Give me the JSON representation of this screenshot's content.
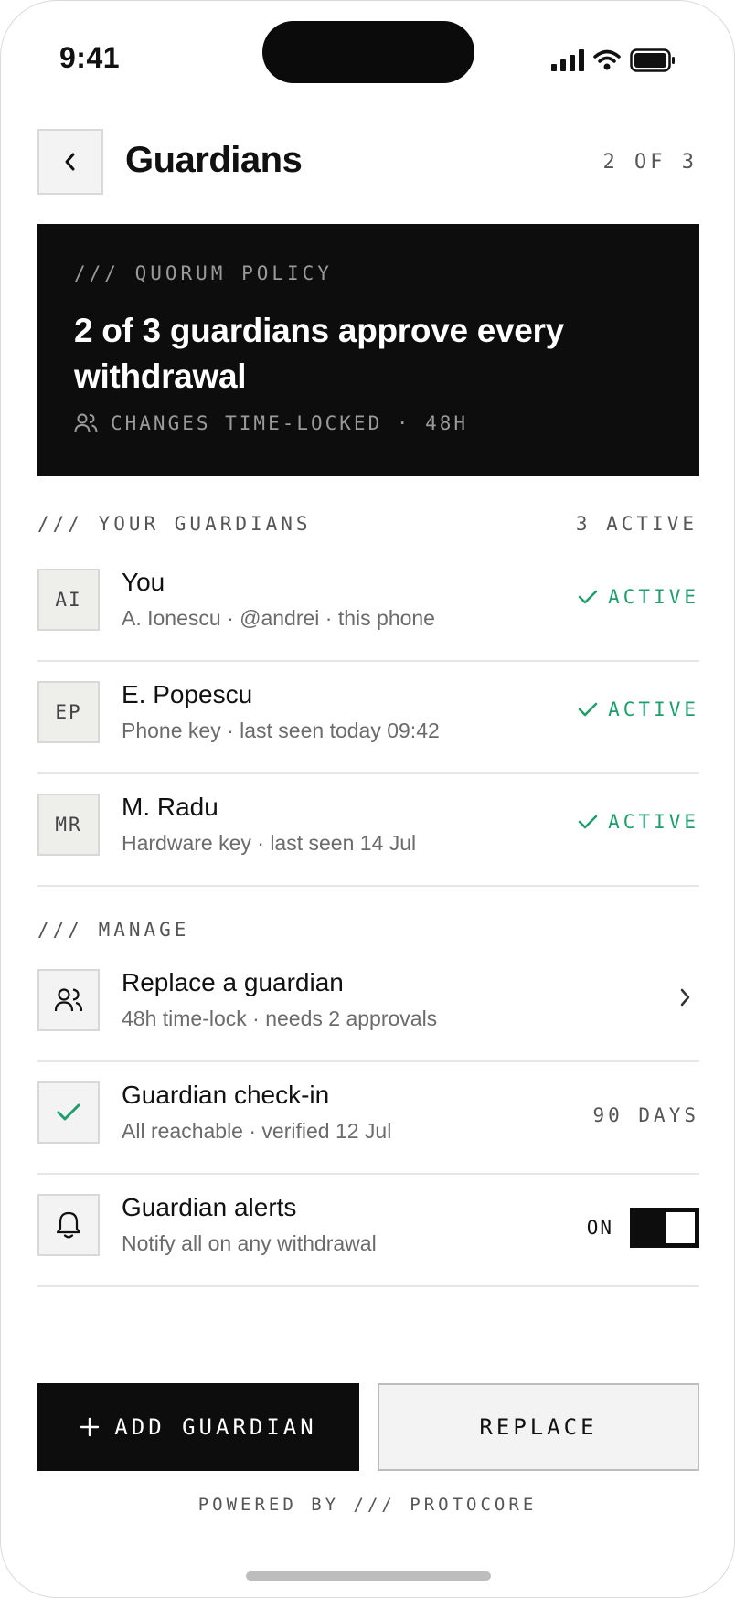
{
  "status_bar": {
    "time": "9:41"
  },
  "header": {
    "title": "Guardians",
    "step": "2 OF 3"
  },
  "policy": {
    "eyebrow": "/// QUORUM POLICY",
    "title": "2 of 3 guardians approve every withdrawal",
    "meta": "CHANGES TIME-LOCKED · 48H"
  },
  "guardians_section": {
    "label": "/// YOUR GUARDIANS",
    "count": "3 ACTIVE",
    "items": [
      {
        "initials": "AI",
        "name": "You",
        "detail": "A. Ionescu · @andrei · this phone",
        "status": "ACTIVE"
      },
      {
        "initials": "EP",
        "name": "E. Popescu",
        "detail": "Phone key · last seen today 09:42",
        "status": "ACTIVE"
      },
      {
        "initials": "MR",
        "name": "M. Radu",
        "detail": "Hardware key · last seen 14 Jul",
        "status": "ACTIVE"
      }
    ]
  },
  "manage_section": {
    "label": "/// MANAGE",
    "replace": {
      "title": "Replace a guardian",
      "detail": "48h time-lock · needs 2 approvals",
      "icon": "users-icon"
    },
    "checkin": {
      "title": "Guardian check-in",
      "detail": "All reachable · verified 12 Jul",
      "value": "90 DAYS",
      "icon": "check-icon"
    },
    "alerts": {
      "title": "Guardian alerts",
      "detail": "Notify all on any withdrawal",
      "state": "ON",
      "enabled": true,
      "icon": "bell-icon"
    }
  },
  "actions": {
    "add_label": "ADD GUARDIAN",
    "replace_label": "REPLACE"
  },
  "footer": {
    "powered": "POWERED BY /// PROTOCORE"
  },
  "colors": {
    "accent_green": "#1e9e6a",
    "ink": "#0d0d0d",
    "muted": "#6b6b6b"
  }
}
